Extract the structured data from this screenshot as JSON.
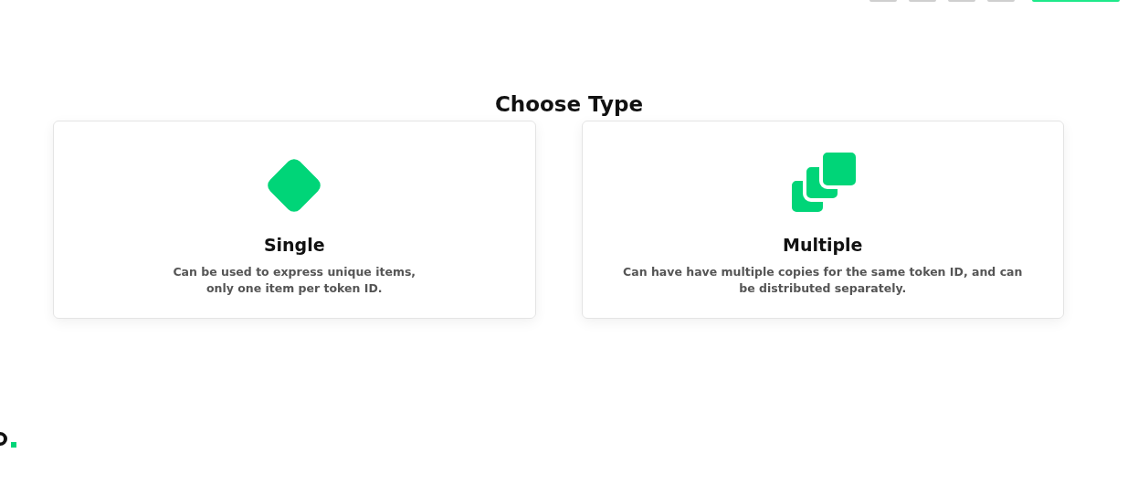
{
  "heading": "Choose Type",
  "options": [
    {
      "kind": "single",
      "title": "Single",
      "description": "Can be used to express unique items, only one item per token ID."
    },
    {
      "kind": "multiple",
      "title": "Multiple",
      "description": "Can have have multiple copies for the same token ID, and can be distributed separately."
    }
  ]
}
